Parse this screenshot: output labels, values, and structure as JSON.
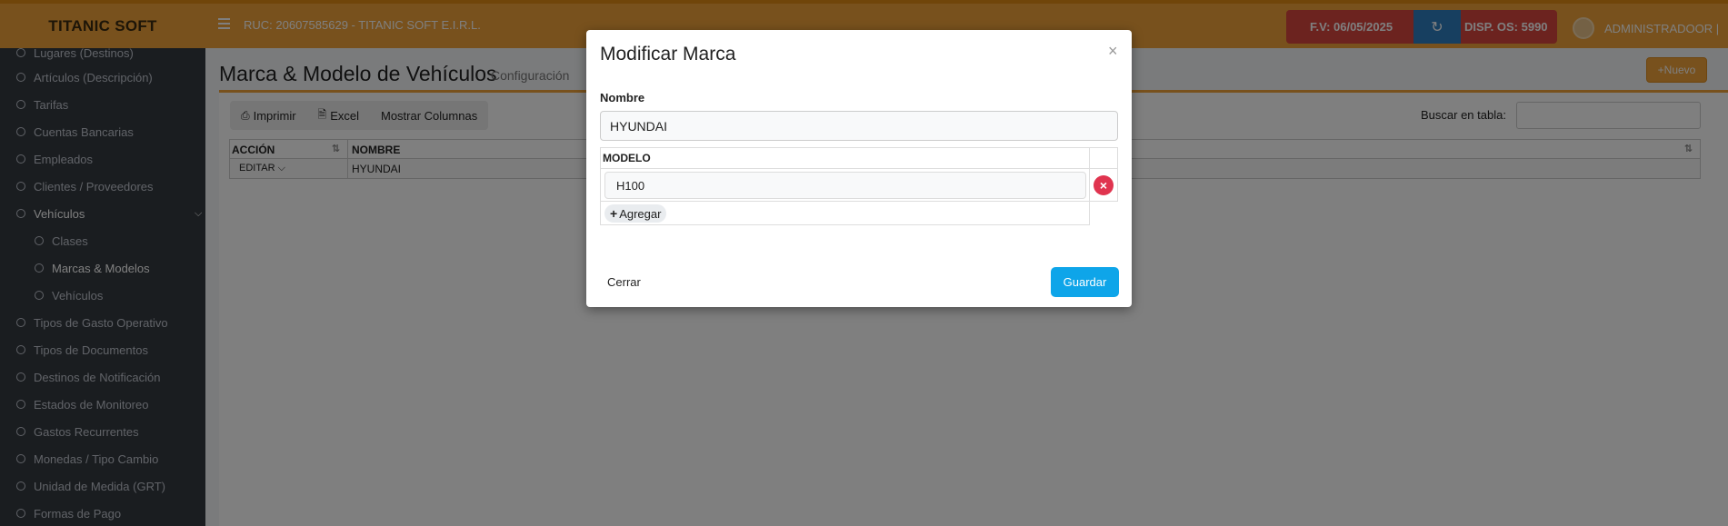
{
  "header": {
    "brand": "TITANIC SOFT",
    "ruc": "RUC: 20607585629 - TITANIC SOFT E.I.R.L.",
    "fv": "F.V: 06/05/2025",
    "disp": "DISP. OS:  5990",
    "user": "ADMINISTRADOOR |"
  },
  "sidebar": {
    "items": [
      {
        "label": "Lugares (Destinos)"
      },
      {
        "label": "Artículos (Descripción)"
      },
      {
        "label": "Tarifas"
      },
      {
        "label": "Cuentas Bancarias"
      },
      {
        "label": "Empleados"
      },
      {
        "label": "Clientes / Proveedores"
      },
      {
        "label": "Vehículos"
      },
      {
        "label": "Clases"
      },
      {
        "label": "Marcas & Modelos"
      },
      {
        "label": "Vehículos"
      },
      {
        "label": "Tipos de Gasto Operativo"
      },
      {
        "label": "Tipos de Documentos"
      },
      {
        "label": "Destinos de Notificación"
      },
      {
        "label": "Estados de Monitoreo"
      },
      {
        "label": "Gastos Recurrentes"
      },
      {
        "label": "Monedas / Tipo Cambio"
      },
      {
        "label": "Unidad de Medida (GRT)"
      },
      {
        "label": "Formas de Pago"
      }
    ]
  },
  "page": {
    "title": "Marca & Modelo de Vehículos",
    "subtitle": "Configuración",
    "new_label": "Nuevo"
  },
  "toolbar": {
    "print_label": "Imprimir",
    "excel_label": "Excel",
    "columns_label": "Mostrar Columnas",
    "search_label": "Buscar en tabla:"
  },
  "table": {
    "headers": [
      "ACCIÓN",
      "NOMBRE"
    ],
    "rows": [
      {
        "action": "EDITAR",
        "nombre": "HYUNDAI"
      }
    ]
  },
  "modal": {
    "title": "Modificar Marca",
    "close_symbol": "×",
    "name_label": "Nombre",
    "name_value": "HYUNDAI",
    "model_header": "MODELO",
    "models": [
      {
        "value": "H100"
      }
    ],
    "add_label": "Agregar",
    "cancel_label": "Cerrar",
    "save_label": "Guardar"
  }
}
